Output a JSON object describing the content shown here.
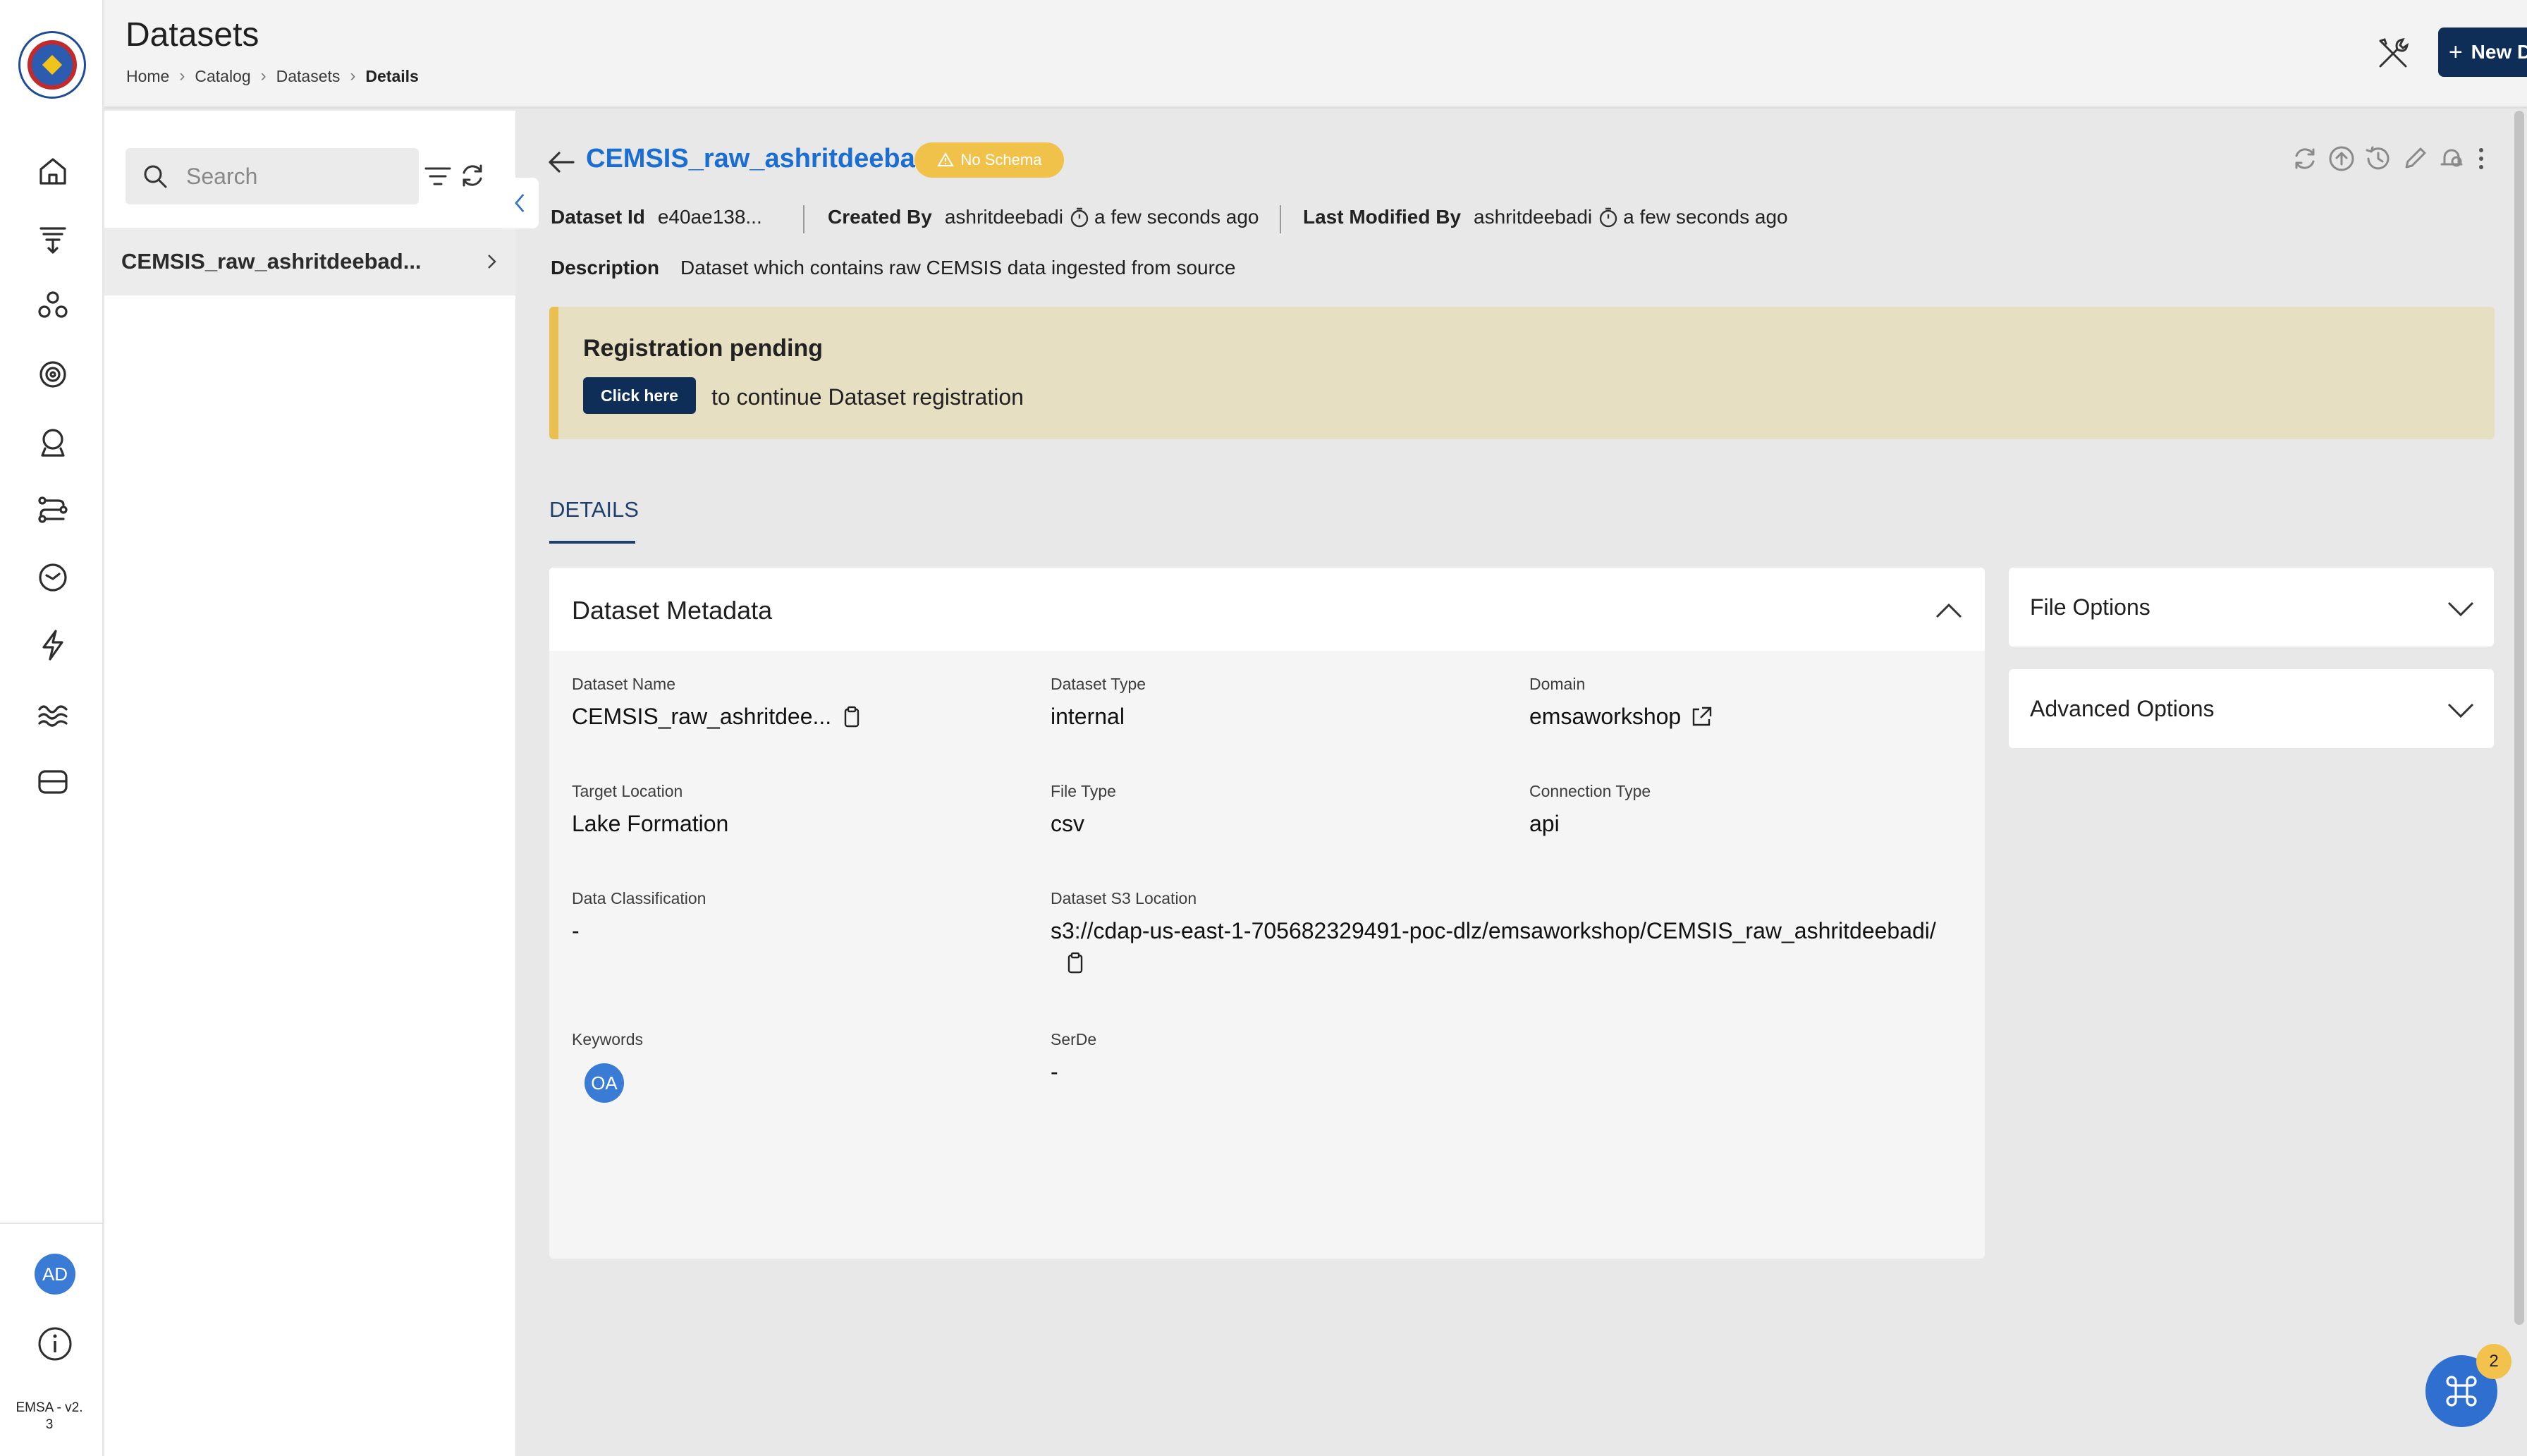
{
  "app": {
    "version": "EMSA - v2.\n3",
    "user_initials": "AD"
  },
  "header": {
    "title": "Datasets",
    "breadcrumb": [
      "Home",
      "Catalog",
      "Datasets",
      "Details"
    ],
    "new_dataset_label": "New Dataset"
  },
  "sidebar": {
    "icons": [
      "home-icon",
      "pipelines-icon",
      "users-icon",
      "settings-icon",
      "models-icon",
      "workflows-icon",
      "clock-icon",
      "lightning-icon",
      "water-icon",
      "storage-icon"
    ]
  },
  "list": {
    "search_placeholder": "Search",
    "items": [
      {
        "label": "CEMSIS_raw_ashritdeebad..."
      }
    ]
  },
  "detail": {
    "title": "CEMSIS_raw_ashritdeebadi",
    "schema_badge": "No Schema",
    "dataset_id_label": "Dataset Id",
    "dataset_id": "e40ae138...",
    "created_by_label": "Created By",
    "created_by": "ashritdeebadi",
    "created_time": "a few seconds ago",
    "modified_by_label": "Last Modified By",
    "modified_by": "ashritdeebadi",
    "modified_time": "a few seconds ago",
    "description_label": "Description",
    "description": "Dataset which contains raw CEMSIS data ingested from source",
    "registration": {
      "title": "Registration pending",
      "button": "Click here",
      "text": "to continue Dataset registration"
    },
    "tab": "DETAILS",
    "metadata": {
      "title": "Dataset Metadata",
      "fields": {
        "dataset_name": {
          "label": "Dataset Name",
          "value": "CEMSIS_raw_ashritdee..."
        },
        "dataset_type": {
          "label": "Dataset Type",
          "value": "internal"
        },
        "domain": {
          "label": "Domain",
          "value": "emsaworkshop"
        },
        "target_location": {
          "label": "Target Location",
          "value": "Lake Formation"
        },
        "file_type": {
          "label": "File Type",
          "value": "csv"
        },
        "connection_type": {
          "label": "Connection Type",
          "value": "api"
        },
        "data_classification": {
          "label": "Data Classification",
          "value": "-"
        },
        "s3_location": {
          "label": "Dataset S3 Location",
          "value": "s3://cdap-us-east-1-705682329491-poc-dlz/emsaworkshop/CEMSIS_raw_ashritdeebadi/"
        },
        "keywords": {
          "label": "Keywords",
          "chip": "OA"
        },
        "serde": {
          "label": "SerDe",
          "value": "-"
        }
      }
    },
    "side_cards": {
      "file_options": "File Options",
      "advanced_options": "Advanced Options"
    }
  },
  "fab": {
    "badge": "2"
  },
  "colors": {
    "primary_dark": "#0f2e57",
    "link_blue": "#1b6ed1",
    "warning": "#f0c24a",
    "banner_bg": "#e7dfc1"
  }
}
